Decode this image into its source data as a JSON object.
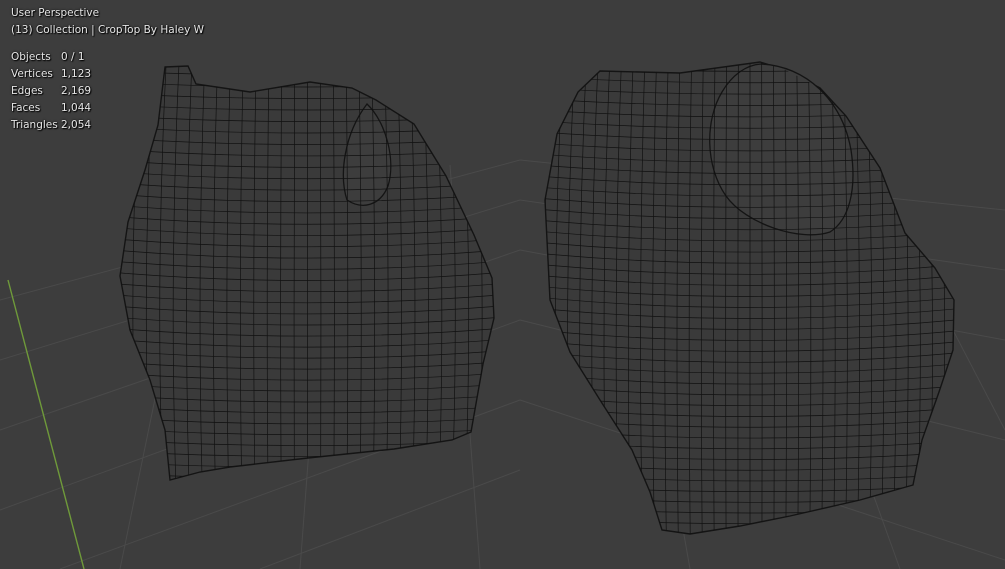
{
  "viewport": {
    "view_name": "User Perspective",
    "collection_line": "(13) Collection | CropTop By Haley W",
    "stats": [
      {
        "label": "Objects",
        "value": "0 / 1"
      },
      {
        "label": "Vertices",
        "value": "1,123"
      },
      {
        "label": "Edges",
        "value": "2,169"
      },
      {
        "label": "Faces",
        "value": "1,044"
      },
      {
        "label": "Triangles",
        "value": "2,054"
      }
    ]
  },
  "colors": {
    "background": "#3d3d3d",
    "grid": "#4a4a4a",
    "y_axis": "#6f9a3a",
    "mesh_fill": "#3a3a3a",
    "wire": "#111111",
    "text": "#e6e6e6"
  }
}
